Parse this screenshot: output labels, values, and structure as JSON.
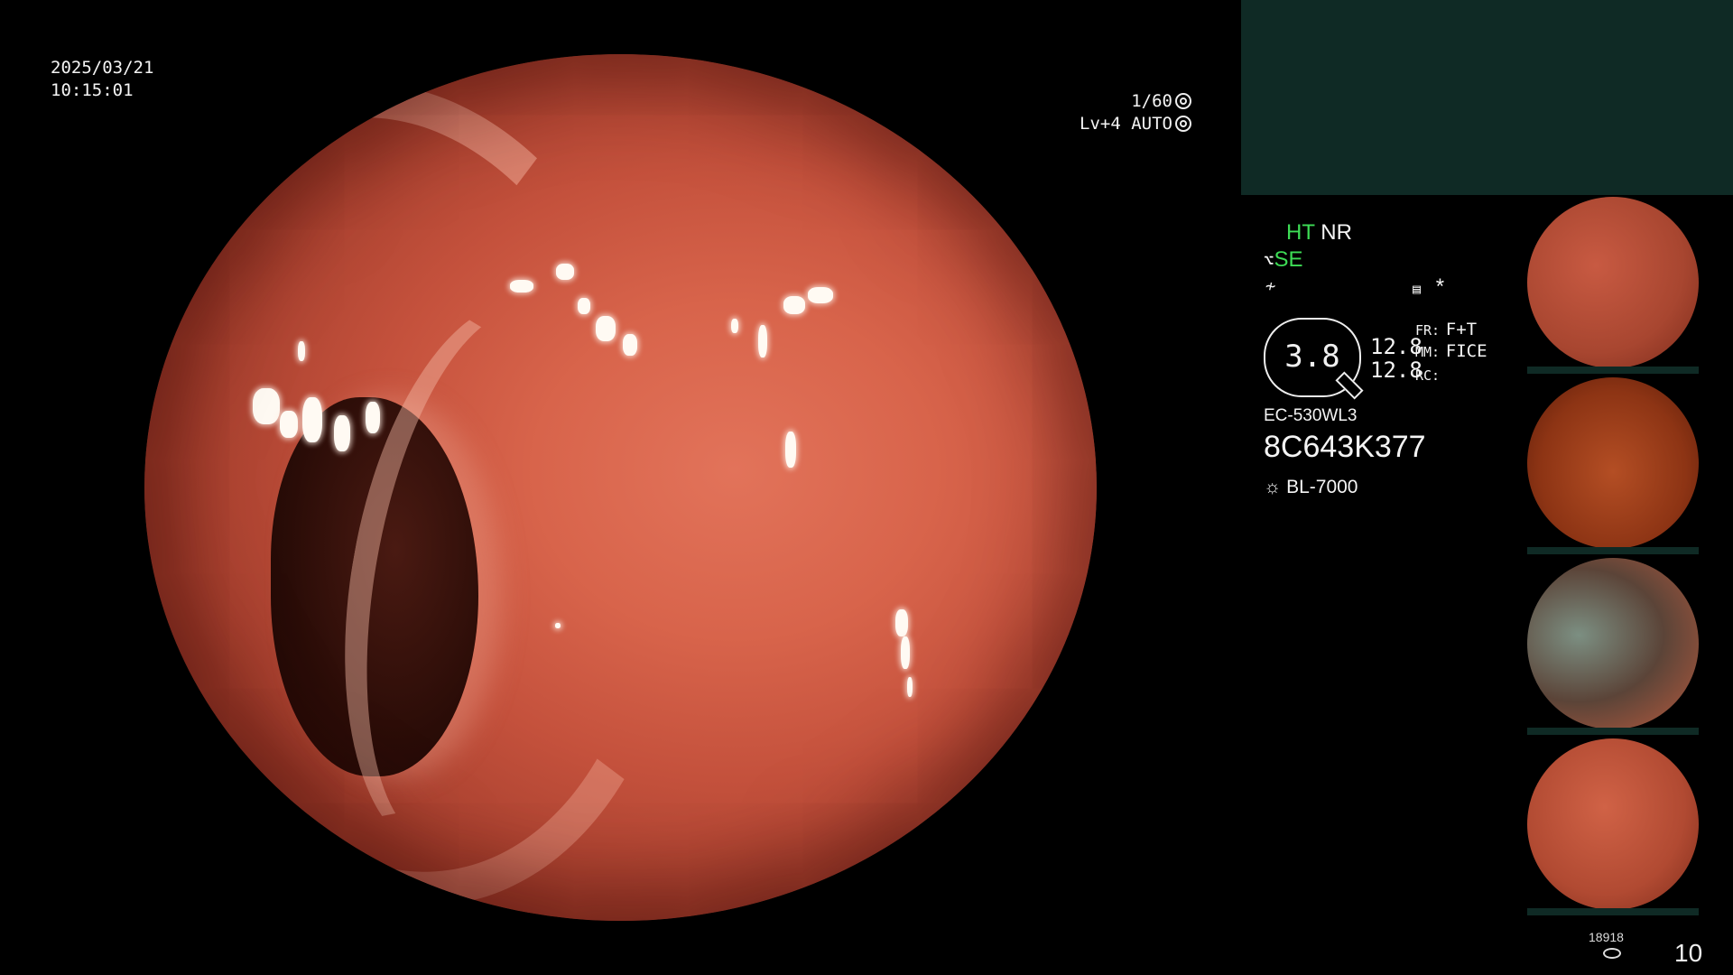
{
  "overlay": {
    "date": "2025/03/21",
    "time": "10:15:01",
    "shutter": "1/60",
    "level": "Lv+4",
    "iris": "AUTO"
  },
  "settings": {
    "ht": "HT",
    "nr": "NR",
    "se": "SE",
    "asterisk": "*",
    "zoom": "3.8",
    "val1": "12.8",
    "val2": "12.8",
    "fr_label": "FR:",
    "fr_value": "F+T",
    "mm_label": "MM:",
    "mm_value": "FICE",
    "rc_label": "RC:",
    "scope_model": "EC-530WL3",
    "serial": "8C643K377",
    "light_source": "BL-7000"
  },
  "footer": {
    "counter": "18918",
    "page": "10"
  },
  "colors": {
    "panel_green": "#0f2a25",
    "text_green": "#3ddc55"
  }
}
